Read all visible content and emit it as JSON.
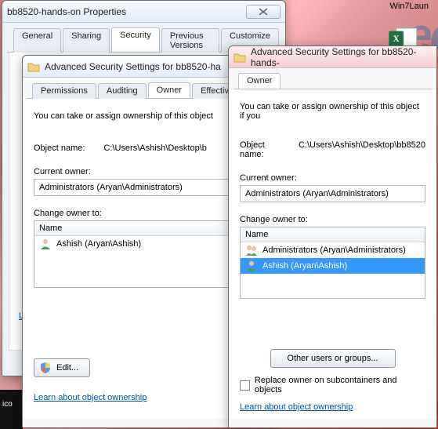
{
  "desktop": {
    "shortcut_label": "Win7Laun",
    "taskbar_label": "ico"
  },
  "properties_window": {
    "title": "bb8520-hands-on Properties",
    "tabs": [
      "General",
      "Sharing",
      "Security",
      "Previous Versions",
      "Customize"
    ],
    "active_tab_index": 2,
    "object_label_truncated": "L",
    "edit_button": "Edit...",
    "learn_link": "Learn about object ownership"
  },
  "advanced_a": {
    "title": "Advanced Security Settings for bb8520-ha",
    "tabs": [
      "Permissions",
      "Auditing",
      "Owner",
      "Effective Perm"
    ],
    "active_tab_index": 2,
    "intro": "You can take or assign ownership of this object",
    "object_name_label": "Object name:",
    "object_name_value": "C:\\Users\\Ashish\\Desktop\\b",
    "current_owner_label": "Current owner:",
    "current_owner_value": "Administrators (Aryan\\Administrators)",
    "change_owner_label": "Change owner to:",
    "list_header": "Name",
    "list_items": [
      {
        "icon": "user",
        "text": "Ashish (Aryan\\Ashish)",
        "selected": false
      }
    ],
    "edit_button": "Edit...",
    "learn_link": "Learn about object ownership"
  },
  "advanced_b": {
    "title": "Advanced Security Settings for bb8520-hands-",
    "tabs": [
      "Owner"
    ],
    "active_tab_index": 0,
    "intro": "You can take or assign ownership of this object if you",
    "object_name_label": "Object name:",
    "object_name_value": "C:\\Users\\Ashish\\Desktop\\bb8520",
    "current_owner_label": "Current owner:",
    "current_owner_value": "Administrators (Aryan\\Administrators)",
    "change_owner_label": "Change owner to:",
    "list_header": "Name",
    "list_items": [
      {
        "icon": "group",
        "text": "Administrators (Aryan\\Administrators)",
        "selected": false
      },
      {
        "icon": "user",
        "text": "Ashish (Aryan\\Ashish)",
        "selected": true
      }
    ],
    "other_users_button": "Other users or groups...",
    "replace_checkbox": "Replace owner on subcontainers and objects",
    "learn_link": "Learn about object ownership"
  }
}
